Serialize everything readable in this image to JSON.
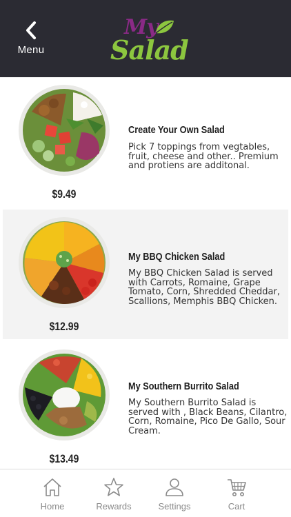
{
  "header": {
    "back_label": "Menu",
    "logo_line1": "My",
    "logo_line2": "Salad"
  },
  "menu_items": [
    {
      "title": "Create Your Own Salad",
      "description": "Pick 7 toppings from vegtables, fruit, cheese and other.. Premium and protiens are additonal.",
      "price": "$9.49"
    },
    {
      "title": "My BBQ Chicken Salad",
      "description": "My BBQ Chicken Salad is served with Carrots, Romaine, Grape Tomato, Corn, Shredded Cheddar, Scallions, Memphis BBQ Chicken.",
      "price": "$12.99"
    },
    {
      "title": "My Southern Burrito Salad",
      "description": "My Southern Burrito Salad is served with , Black Beans, Cilantro, Corn, Romaine, Pico De Gallo, Sour Cream.",
      "price": "$13.49"
    }
  ],
  "tabs": [
    {
      "label": "Home",
      "icon": "home-icon"
    },
    {
      "label": "Rewards",
      "icon": "star-icon"
    },
    {
      "label": "Settings",
      "icon": "person-icon"
    },
    {
      "label": "Cart",
      "icon": "cart-icon"
    }
  ],
  "colors": {
    "header_bg": "#2b2b33",
    "logo_purple": "#8a2a86",
    "logo_green": "#8cc63f",
    "alt_row_bg": "#f3f3f3",
    "tab_gray": "#8a8a8a"
  }
}
